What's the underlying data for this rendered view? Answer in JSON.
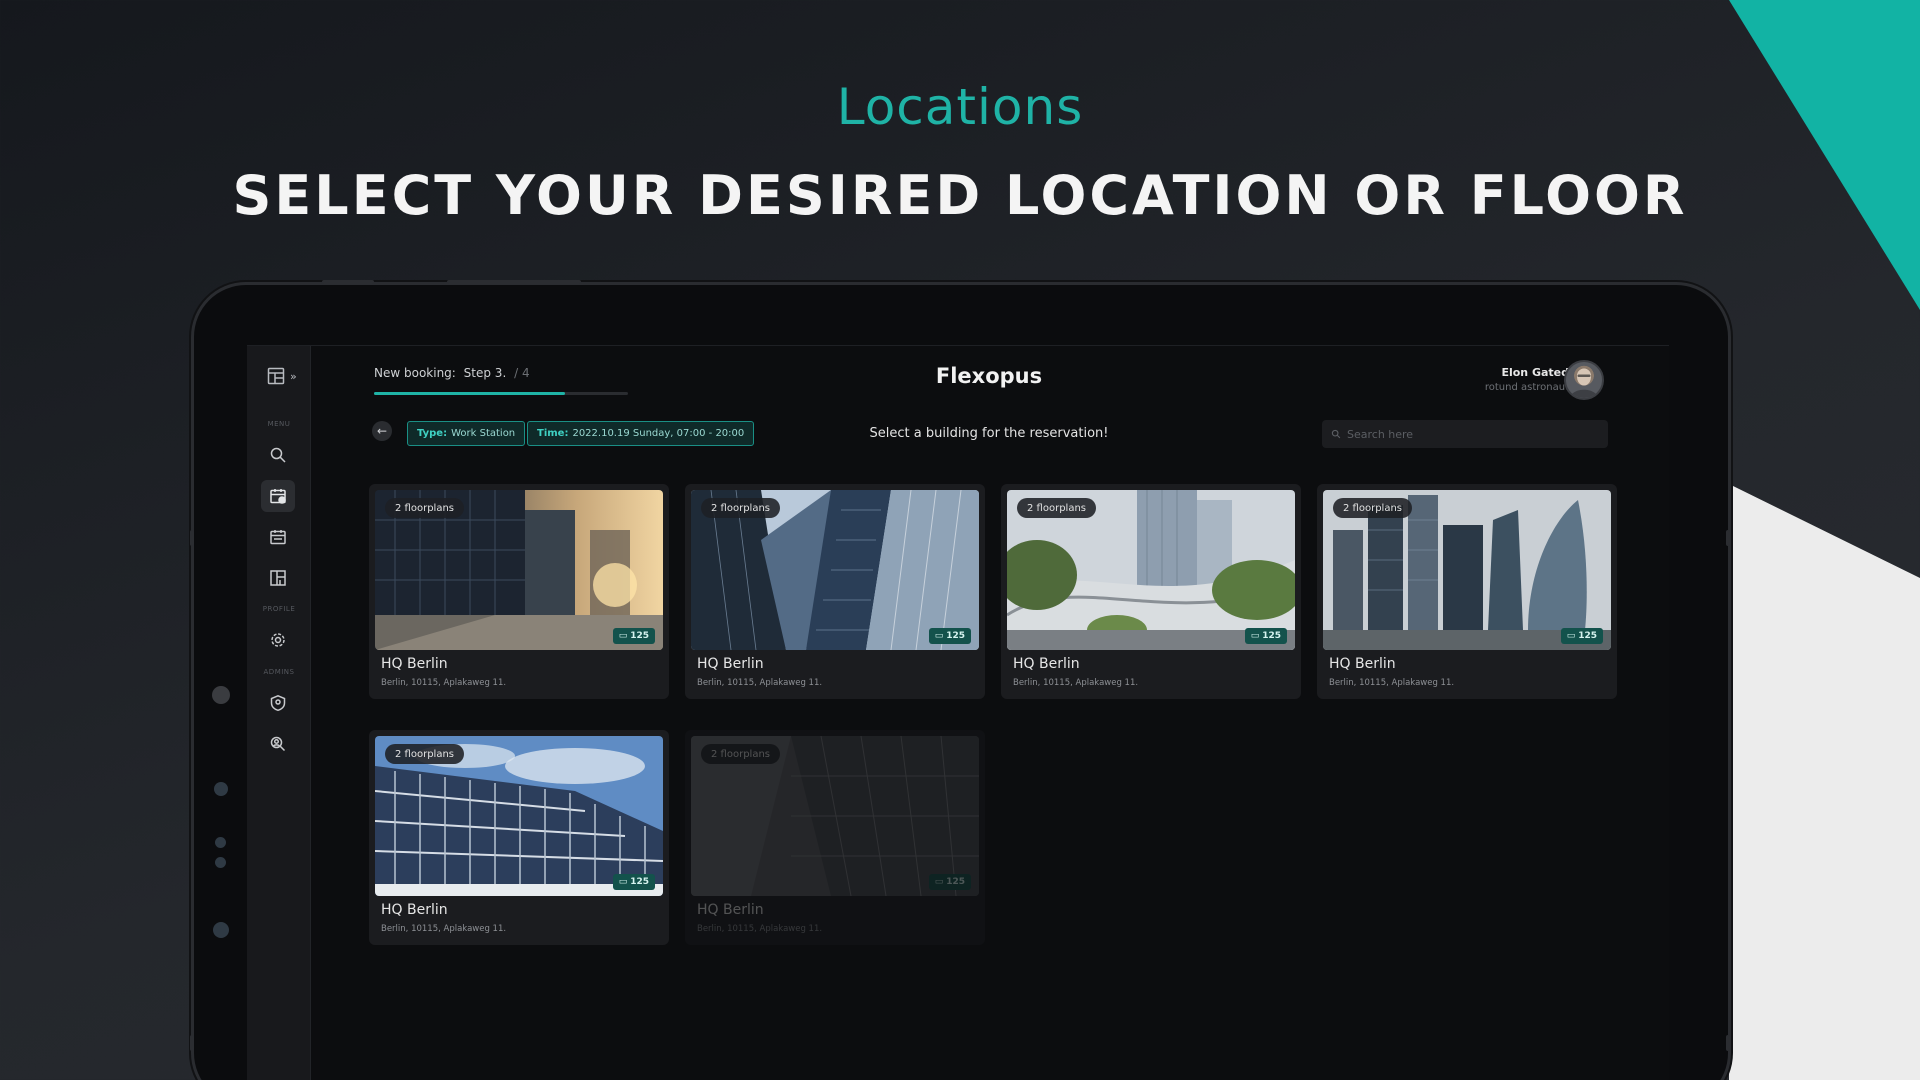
{
  "colors": {
    "accent": "#1fb3a6",
    "background": "#1c1f24",
    "screen": "#0c0d0f"
  },
  "headline": {
    "sub": "Locations",
    "main": "SELECT YOUR DESIRED LOCATION OR FLOOR"
  },
  "sidebar": {
    "collapse_icon": "layout-expand-icon",
    "sections": [
      {
        "label": "MENU"
      },
      {
        "label": "PROFILE"
      },
      {
        "label": "ADMINS"
      }
    ],
    "items": [
      {
        "icon": "search-icon",
        "section": "MENU"
      },
      {
        "icon": "calendar-check-icon",
        "section": "MENU",
        "active": true
      },
      {
        "icon": "calendar-icon",
        "section": "MENU"
      },
      {
        "icon": "floorplan-icon",
        "section": "MENU"
      },
      {
        "icon": "gear-icon",
        "section": "PROFILE"
      },
      {
        "icon": "shield-user-icon",
        "section": "ADMINS"
      },
      {
        "icon": "users-manage-icon",
        "section": "ADMINS"
      }
    ]
  },
  "header": {
    "booking_label": "New booking:",
    "step": "Step 3.",
    "total": "/ 4",
    "progress": 0.75,
    "brand": "Flexopus",
    "user_name": "Elon Gated",
    "user_role": "rotund astronaut"
  },
  "filters": {
    "back_icon": "arrow-left-icon",
    "type_key": "Type:",
    "type_value": "Work Station",
    "time_key": "Time:",
    "time_value": "2022.10.19 Sunday, 07:00 - 20:00",
    "instruction": "Select a building for the reservation!",
    "search_placeholder": "Search here"
  },
  "locations": [
    {
      "floorplans": "2 floorplans",
      "seats": "125",
      "name": "HQ Berlin",
      "address": "Berlin, 10115, Aplakaweg 11."
    },
    {
      "floorplans": "2 floorplans",
      "seats": "125",
      "name": "HQ Berlin",
      "address": "Berlin, 10115, Aplakaweg 11."
    },
    {
      "floorplans": "2 floorplans",
      "seats": "125",
      "name": "HQ Berlin",
      "address": "Berlin, 10115, Aplakaweg 11."
    },
    {
      "floorplans": "2 floorplans",
      "seats": "125",
      "name": "HQ Berlin",
      "address": "Berlin, 10115, Aplakaweg 11."
    },
    {
      "floorplans": "2 floorplans",
      "seats": "125",
      "name": "HQ Berlin",
      "address": "Berlin, 10115, Aplakaweg 11."
    },
    {
      "floorplans": "2 floorplans",
      "seats": "125",
      "name": "HQ Berlin",
      "address": "Berlin, 10115, Aplakaweg 11.",
      "disabled": true
    }
  ]
}
